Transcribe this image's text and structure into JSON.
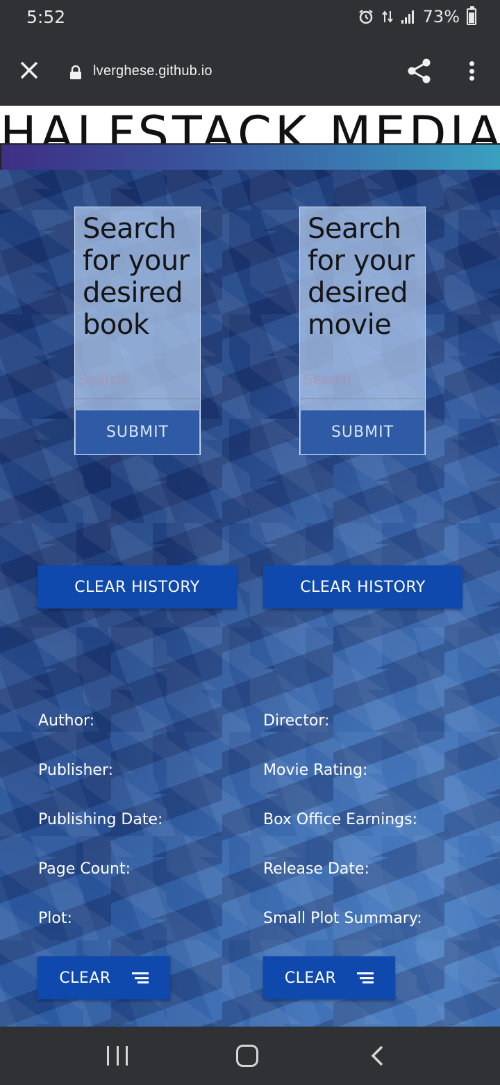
{
  "status_bar": {
    "time": "5:52",
    "battery": "73%",
    "battery_level": 0.73,
    "icons": [
      "alarm-icon",
      "data-transfer-icon",
      "signal-icon",
      "battery-icon"
    ]
  },
  "browser": {
    "url": "lverghese.github.io",
    "icons": [
      "close-icon",
      "lock-icon",
      "share-icon",
      "more-icon"
    ]
  },
  "header": {
    "title": "HALFSTACK MEDIA"
  },
  "book_search": {
    "title": "Search for your desired book",
    "placeholder": "Search",
    "submit_label": "SUBMIT",
    "clear_history_label": "CLEAR HISTORY",
    "fields": [
      "Author:",
      "Publisher:",
      "Publishing Date:",
      "Page Count:",
      "Plot:"
    ],
    "clear_label": "CLEAR"
  },
  "movie_search": {
    "title": "Search for your desired movie",
    "placeholder": "Search",
    "submit_label": "SUBMIT",
    "clear_history_label": "CLEAR HISTORY",
    "fields": [
      "Director:",
      "Movie Rating:",
      "Box Office Earnings:",
      "Release Date:",
      "Small Plot Summary:"
    ],
    "clear_label": "CLEAR"
  },
  "colors": {
    "button": "#0f49ad",
    "card": "#b4cdf0",
    "gradient_start": "#3e2f85",
    "gradient_end": "#3aa0c0"
  }
}
